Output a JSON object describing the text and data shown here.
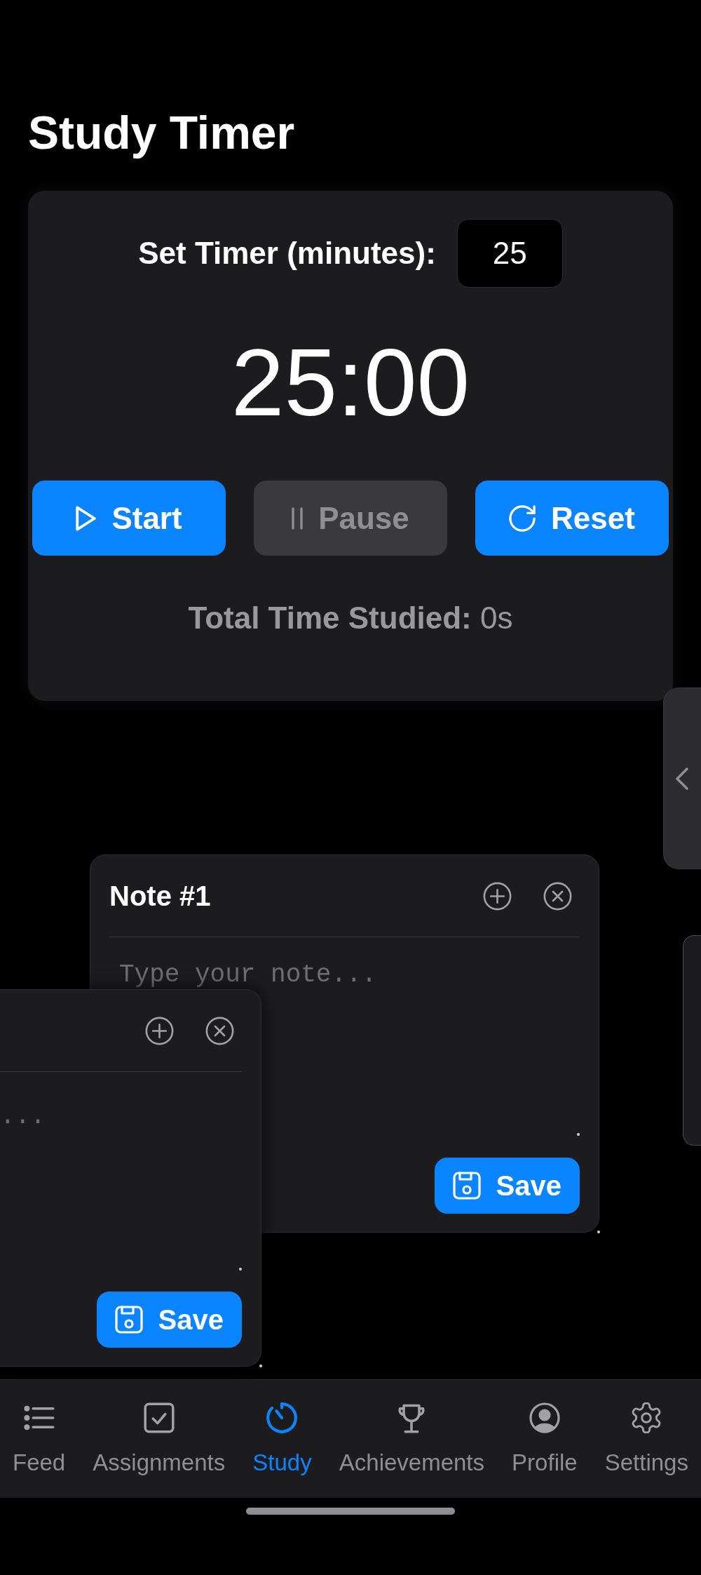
{
  "screen": {
    "title": "Study Timer"
  },
  "timer_card": {
    "set_timer_label": "Set Timer (minutes):",
    "minutes_field": {
      "value": "25"
    },
    "countdown": "25:00",
    "buttons": [
      {
        "kind": "start",
        "label": "Start",
        "disabled": false
      },
      {
        "kind": "pause",
        "label": "Pause",
        "disabled": true
      },
      {
        "kind": "reset",
        "label": "Reset",
        "disabled": false
      }
    ],
    "total_time": "**Total Time Studied:** 0s"
  },
  "notes": [
    {
      "title": "Note #1",
      "placeholder": "Type your note...",
      "save_label": "Save"
    },
    {
      "placeholder": "...",
      "save_label": "Save"
    }
  ],
  "bottom_nav": {
    "items": [
      {
        "kind": "list",
        "label": "Feed",
        "selected": false
      },
      {
        "kind": "checkbox",
        "label": "Assignments",
        "selected": false
      },
      {
        "kind": "timer",
        "label": "Study",
        "selected": true
      },
      {
        "kind": "trophy",
        "label": "Achievements",
        "selected": false
      },
      {
        "kind": "user",
        "label": "Profile",
        "selected": false
      },
      {
        "kind": "gear",
        "label": "Settings",
        "selected": false
      }
    ]
  }
}
